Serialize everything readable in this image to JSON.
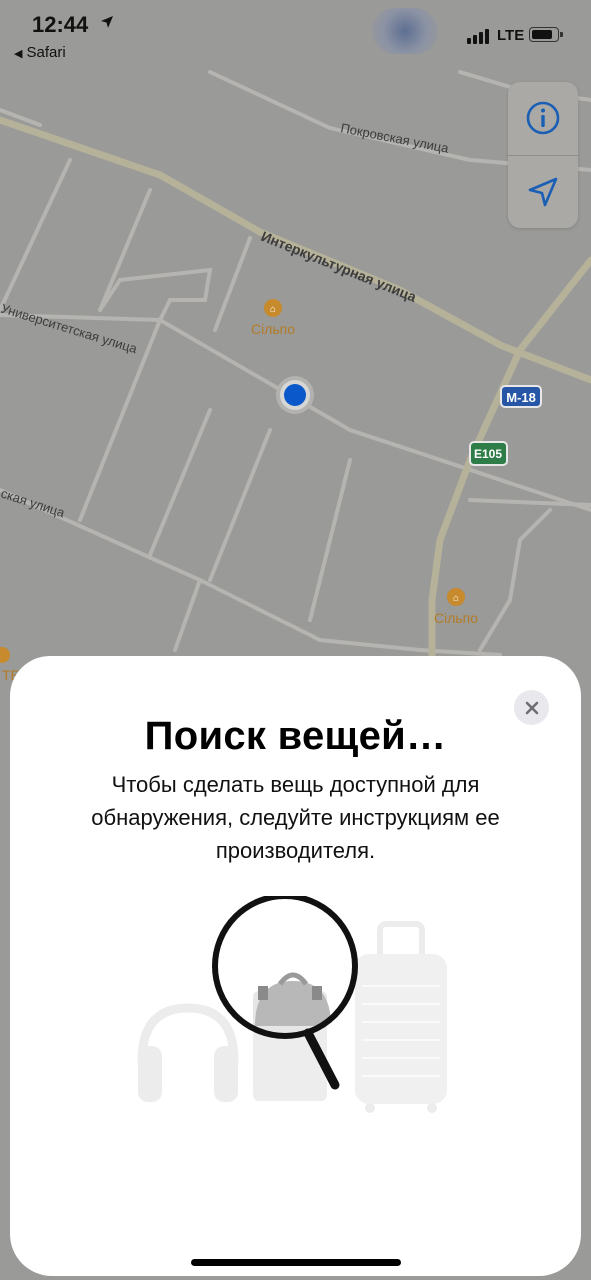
{
  "status_bar": {
    "time": "12:44",
    "back_app": "Safari",
    "network": "LTE"
  },
  "map": {
    "streets": [
      "Покровская улица",
      "Интеркультурная улица",
      "Университетская улица",
      "ская улица"
    ],
    "pois": [
      "Сільпо",
      "Сільпо",
      "ТБ"
    ],
    "route_shields": [
      "M-18",
      "E105"
    ],
    "controls": {
      "info_icon": "info-icon",
      "location_icon": "location-arrow-icon"
    }
  },
  "sheet": {
    "title": "Поиск вещей…",
    "description": "Чтобы сделать вещь доступной для обнаружения, следуйте инструкциям ее производителя.",
    "close_icon": "close-icon",
    "illustration_icons": [
      "headphones-icon",
      "backpack-icon",
      "magnifier-icon",
      "suitcase-icon"
    ]
  },
  "colors": {
    "map_bg": "#9a9a98",
    "user_dot": "#0a58c9",
    "control_icon": "#1a5fb4",
    "sheet_bg": "#ffffff"
  }
}
